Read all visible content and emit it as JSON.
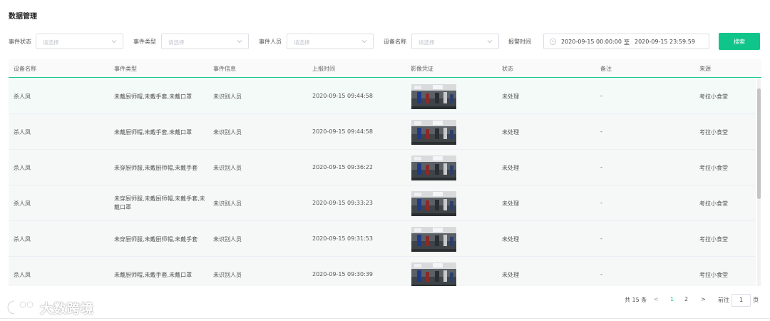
{
  "page": {
    "title": "数据管理"
  },
  "filters": {
    "status_label": "事件状态",
    "type_label": "事件类型",
    "person_label": "事件人员",
    "device_label": "设备名称",
    "time_label": "报警时间",
    "placeholder": "请选择",
    "date_start": "2020-09-15 00:00:00",
    "date_sep": "至",
    "date_end": "2020-09-15 23:59:59",
    "search_label": "搜索"
  },
  "table": {
    "headers": [
      "设备名称",
      "事件类型",
      "事件信息",
      "上报时间",
      "影像凭证",
      "状态",
      "备注",
      "来源"
    ],
    "rows": [
      {
        "device": "杀人凤",
        "type": "未戴厨师帽,未戴手套,未戴口罩",
        "info": "未识别人员",
        "time": "2020-09-15 09:44:58",
        "status": "未处理",
        "note": "-",
        "source": "考拉小食堂"
      },
      {
        "device": "杀人凤",
        "type": "未戴厨师帽,未戴手套,未戴口罩",
        "info": "未识别人员",
        "time": "2020-09-15 09:44:58",
        "status": "未处理",
        "note": "-",
        "source": "考拉小食堂"
      },
      {
        "device": "杀人凤",
        "type": "未穿厨师服,未戴厨师帽,未戴手套",
        "info": "未识别人员",
        "time": "2020-09-15 09:36:22",
        "status": "未处理",
        "note": "-",
        "source": "考拉小食堂"
      },
      {
        "device": "杀人凤",
        "type": "未穿厨师服,未戴厨师帽,未戴手套,未戴口罩",
        "info": "未识别人员",
        "time": "2020-09-15 09:33:23",
        "status": "未处理",
        "note": "-",
        "source": "考拉小食堂"
      },
      {
        "device": "杀人凤",
        "type": "未穿厨师服,未戴厨师帽,未戴手套",
        "info": "未识别人员",
        "time": "2020-09-15 09:31:53",
        "status": "未处理",
        "note": "-",
        "source": "考拉小食堂"
      },
      {
        "device": "杀人凤",
        "type": "未戴厨师帽,未戴手套,未戴口罩",
        "info": "未识别人员",
        "time": "2020-09-15 09:30:39",
        "status": "未处理",
        "note": "-",
        "source": "考拉小食堂"
      }
    ]
  },
  "pagination": {
    "total": "共 15 条",
    "prev": "<",
    "pages": [
      "1",
      "2"
    ],
    "next": ">",
    "goto_label": "前往",
    "goto_value": "1",
    "page_unit": "页"
  },
  "watermark": {
    "text": "大数跨境"
  },
  "colors": {
    "accent": "#10c589",
    "border": "#dcdfe6"
  }
}
